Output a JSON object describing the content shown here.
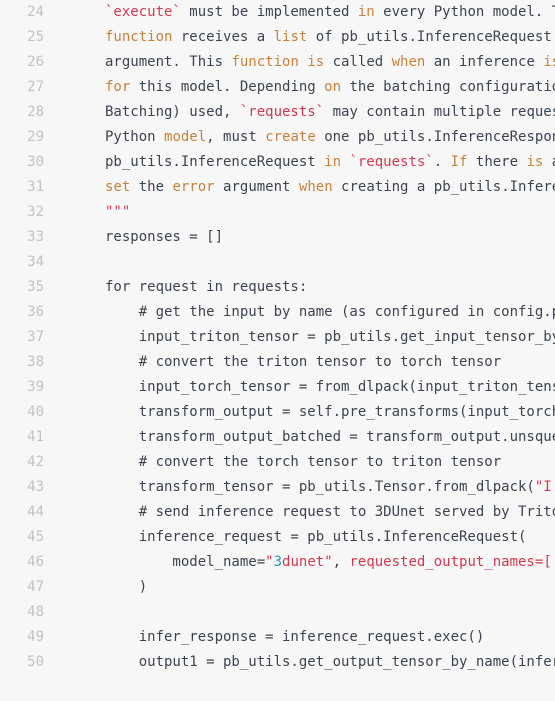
{
  "editor": {
    "language": "python",
    "first_visible_line": 24,
    "last_visible_line": 50,
    "background_color": "#f7f7f7",
    "gutter_color": "#c2c2c6",
    "text_color": "#3c4451",
    "keyword_color": "#c9803a",
    "string_color": "#d4384f",
    "number_color": "#1a9fc4"
  },
  "lines": [
    {
      "number": "24",
      "text": "`execute` must be implemented in every Python model. T",
      "tokens": [
        {
          "t": "`execute`",
          "c": "str"
        },
        {
          "t": " must be implemented ",
          "c": "plain"
        },
        {
          "t": "in",
          "c": "kw"
        },
        {
          "t": " every Python model. T",
          "c": "plain"
        }
      ]
    },
    {
      "number": "25",
      "text": "function receives a list of pb_utils.InferenceRequest",
      "tokens": [
        {
          "t": "function",
          "c": "kw"
        },
        {
          "t": " receives a ",
          "c": "plain"
        },
        {
          "t": "list",
          "c": "kw"
        },
        {
          "t": " of pb_utils.InferenceRequest",
          "c": "plain"
        }
      ]
    },
    {
      "number": "26",
      "text": "argument. This function is called when an inference is",
      "tokens": [
        {
          "t": "argument. This ",
          "c": "plain"
        },
        {
          "t": "function",
          "c": "kw"
        },
        {
          "t": " ",
          "c": "plain"
        },
        {
          "t": "is",
          "c": "kw"
        },
        {
          "t": " called ",
          "c": "plain"
        },
        {
          "t": "when",
          "c": "kw"
        },
        {
          "t": " an inference ",
          "c": "plain"
        },
        {
          "t": "is",
          "c": "kw"
        }
      ]
    },
    {
      "number": "27",
      "text": "for this model. Depending on the batching configuratio",
      "tokens": [
        {
          "t": "for",
          "c": "kw"
        },
        {
          "t": " this model. Depending ",
          "c": "plain"
        },
        {
          "t": "on",
          "c": "kw"
        },
        {
          "t": " the batching configuratio",
          "c": "plain"
        }
      ]
    },
    {
      "number": "28",
      "text": "Batching) used, `requests` may contain multiple reques",
      "tokens": [
        {
          "t": "Batching) used, ",
          "c": "plain"
        },
        {
          "t": "`requests`",
          "c": "str"
        },
        {
          "t": " may contain multiple reques",
          "c": "plain"
        }
      ]
    },
    {
      "number": "29",
      "text": "Python model, must create one pb_utils.InferenceRespon",
      "tokens": [
        {
          "t": "Python ",
          "c": "plain"
        },
        {
          "t": "model",
          "c": "kw"
        },
        {
          "t": ", must ",
          "c": "plain"
        },
        {
          "t": "create",
          "c": "kw"
        },
        {
          "t": " one pb_utils.InferenceRespon",
          "c": "plain"
        }
      ]
    },
    {
      "number": "30",
      "text": "pb_utils.InferenceRequest in `requests`. If there is a",
      "tokens": [
        {
          "t": "pb_utils.InferenceRequest ",
          "c": "plain"
        },
        {
          "t": "in",
          "c": "kw"
        },
        {
          "t": " ",
          "c": "plain"
        },
        {
          "t": "`requests`",
          "c": "str"
        },
        {
          "t": ". ",
          "c": "plain"
        },
        {
          "t": "If",
          "c": "kw"
        },
        {
          "t": " there ",
          "c": "plain"
        },
        {
          "t": "is",
          "c": "kw"
        },
        {
          "t": " a",
          "c": "plain"
        }
      ]
    },
    {
      "number": "31",
      "text": "set the error argument when creating a pb_utils.Infere",
      "tokens": [
        {
          "t": "set",
          "c": "kw"
        },
        {
          "t": " the ",
          "c": "plain"
        },
        {
          "t": "error",
          "c": "kw"
        },
        {
          "t": " argument ",
          "c": "plain"
        },
        {
          "t": "when",
          "c": "kw"
        },
        {
          "t": " creating a pb_utils.Infere",
          "c": "plain"
        }
      ]
    },
    {
      "number": "32",
      "text": "\"\"\"",
      "tokens": [
        {
          "t": "\"\"\"",
          "c": "str"
        }
      ]
    },
    {
      "number": "33",
      "text": "responses = []",
      "tokens": [
        {
          "t": "responses = []",
          "c": "plain"
        }
      ]
    },
    {
      "number": "34",
      "text": "",
      "tokens": []
    },
    {
      "number": "35",
      "text": "for request in requests:",
      "tokens": [
        {
          "t": "for request in requests:",
          "c": "plain"
        }
      ]
    },
    {
      "number": "36",
      "text": "    # get the input by name (as configured in config.p",
      "tokens": [
        {
          "t": "    # get the input by name (as configured in config.p",
          "c": "comment"
        }
      ]
    },
    {
      "number": "37",
      "text": "    input_triton_tensor = pb_utils.get_input_tensor_by",
      "tokens": [
        {
          "t": "    input_triton_tensor = pb_utils.get_input_tensor_by",
          "c": "plain"
        }
      ]
    },
    {
      "number": "38",
      "text": "    # convert the triton tensor to torch tensor",
      "tokens": [
        {
          "t": "    # convert the triton tensor to torch tensor",
          "c": "comment"
        }
      ]
    },
    {
      "number": "39",
      "text": "    input_torch_tensor = from_dlpack(input_triton_tens",
      "tokens": [
        {
          "t": "    input_torch_tensor = from_dlpack(input_triton_tens",
          "c": "plain"
        }
      ]
    },
    {
      "number": "40",
      "text": "    transform_output = self.pre_transforms(input_torch",
      "tokens": [
        {
          "t": "    transform_output = self.pre_transforms(input_torch",
          "c": "plain"
        }
      ]
    },
    {
      "number": "41",
      "text": "    transform_output_batched = transform_output.unsque",
      "tokens": [
        {
          "t": "    transform_output_batched = transform_output.unsque",
          "c": "plain"
        }
      ]
    },
    {
      "number": "42",
      "text": "    # convert the torch tensor to triton tensor",
      "tokens": [
        {
          "t": "    # convert the torch tensor to triton tensor",
          "c": "comment"
        }
      ]
    },
    {
      "number": "43",
      "text": "    transform_tensor = pb_utils.Tensor.from_dlpack(\"I",
      "tokens": [
        {
          "t": "    transform_tensor = pb_utils.Tensor.from_dlpack(",
          "c": "plain"
        },
        {
          "t": "\"I",
          "c": "str"
        }
      ]
    },
    {
      "number": "44",
      "text": "    # send inference request to 3DUnet served by Trito",
      "tokens": [
        {
          "t": "    # send inference request to 3DUnet served by Trito",
          "c": "comment"
        }
      ]
    },
    {
      "number": "45",
      "text": "    inference_request = pb_utils.InferenceRequest(",
      "tokens": [
        {
          "t": "    inference_request = pb_utils.InferenceRequest(",
          "c": "plain"
        }
      ]
    },
    {
      "number": "46",
      "text": "        model_name=\"3dunet\", requested_output_names=['",
      "tokens": [
        {
          "t": "        model_name=",
          "c": "plain"
        },
        {
          "t": "\"",
          "c": "str"
        },
        {
          "t": "3",
          "c": "num"
        },
        {
          "t": "dunet\"",
          "c": "str"
        },
        {
          "t": ", ",
          "c": "plain"
        },
        {
          "t": "requested_output_names=['",
          "c": "str"
        }
      ]
    },
    {
      "number": "47",
      "text": "    )",
      "tokens": [
        {
          "t": "    )",
          "c": "plain"
        }
      ]
    },
    {
      "number": "48",
      "text": "",
      "tokens": []
    },
    {
      "number": "49",
      "text": "    infer_response = inference_request.exec()",
      "tokens": [
        {
          "t": "    infer_response = inference_request.exec()",
          "c": "plain"
        }
      ]
    },
    {
      "number": "50",
      "text": "    output1 = pb_utils.get_output_tensor_by_name(infer",
      "tokens": [
        {
          "t": "    output1 = pb_utils.get_output_tensor_by_name(infer",
          "c": "plain"
        }
      ]
    }
  ]
}
